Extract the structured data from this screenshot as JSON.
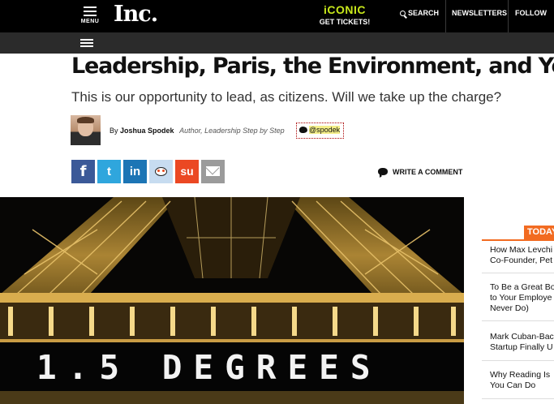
{
  "header": {
    "menu_label": "MENU",
    "logo": "Inc.",
    "promo_brand": "iCONIC",
    "promo_cta": "GET TICKETS!",
    "search_label": "SEARCH",
    "newsletters_label": "NEWSLETTERS",
    "follow_label": "FOLLOW"
  },
  "article": {
    "headline": "Leadership, Paris, the Environment, and You",
    "subheadline": "This is our opportunity to lead, as citizens. Will we take up the charge?",
    "byline_prefix": "By",
    "author": "Joshua Spodek",
    "author_role": "Author, Leadership Step by Step",
    "twitter_handle": "@spodek",
    "comment_label": "WRITE A COMMENT",
    "hero_caption_text": "1.5 DEGREES"
  },
  "share": {
    "facebook": "f",
    "twitter": "t",
    "linkedin": "in",
    "stumbleupon": "su"
  },
  "sidebar": {
    "heading": "TODAY",
    "items": [
      {
        "line1": "How Max Levchi",
        "line2": "Co-Founder, Pet"
      },
      {
        "line1": "To Be a Great Bo",
        "line2": "to Your Employe",
        "line3": "Never Do)"
      },
      {
        "line1": "Mark Cuban-Bac",
        "line2": "Startup Finally U"
      },
      {
        "line1": "Why Reading Is",
        "line2": "You Can Do"
      }
    ]
  },
  "colors": {
    "accent": "#f26b21",
    "promo": "#c8e81b",
    "facebook": "#3b5998",
    "twitter": "#2fa6dd",
    "linkedin": "#1c75b5",
    "stumbleupon": "#eb4823"
  }
}
